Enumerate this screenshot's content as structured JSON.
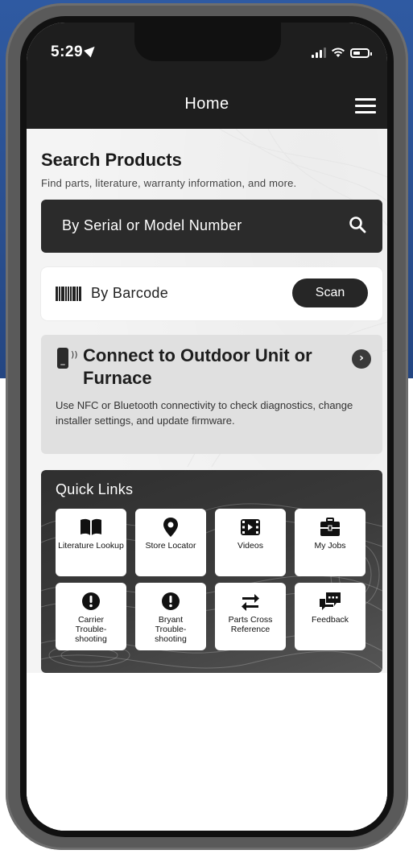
{
  "status_bar": {
    "time": "5:29"
  },
  "nav": {
    "title": "Home"
  },
  "search": {
    "heading": "Search Products",
    "subheading": "Find parts, literature, warranty information, and more.",
    "serial_placeholder": "By Serial or Model Number",
    "barcode_label": "By Barcode",
    "scan_label": "Scan"
  },
  "connect": {
    "title": "Connect to Outdoor Unit or Furnace",
    "description": "Use NFC or Bluetooth connectivity to check diagnostics, change installer settings, and update firmware."
  },
  "quick_links": {
    "title": "Quick Links",
    "tiles": [
      {
        "label": "Literature Lookup",
        "icon": "book-icon"
      },
      {
        "label": "Store Locator",
        "icon": "map-pin-icon"
      },
      {
        "label": "Videos",
        "icon": "film-icon"
      },
      {
        "label": "My Jobs",
        "icon": "briefcase-icon"
      },
      {
        "label": "Carrier Trouble-shooting",
        "icon": "alert-icon"
      },
      {
        "label": "Bryant Trouble-shooting",
        "icon": "alert-icon"
      },
      {
        "label": "Parts Cross Reference",
        "icon": "swap-arrows-icon"
      },
      {
        "label": "Feedback",
        "icon": "chat-bubble-icon"
      }
    ]
  },
  "colors": {
    "nav_bg": "#1e1e1e",
    "background_blue": "#2f5aa2",
    "card_gray": "#e0e0e0"
  }
}
